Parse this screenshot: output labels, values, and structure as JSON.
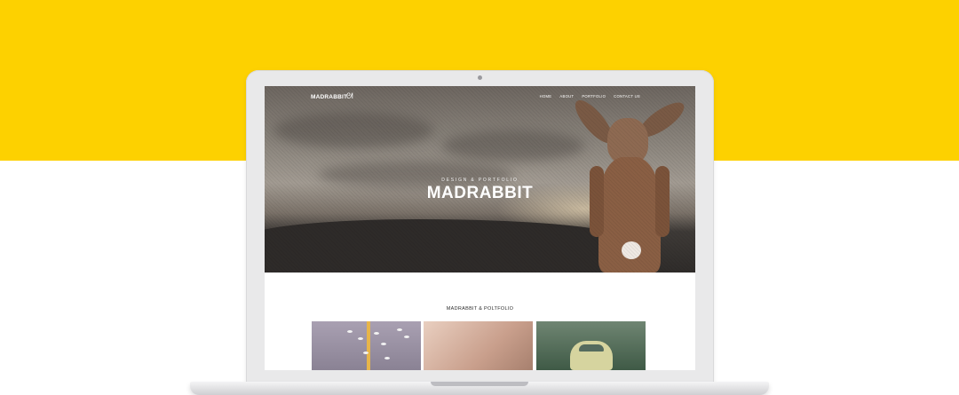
{
  "brand": {
    "logo_text": "MADRABBIT"
  },
  "nav": {
    "items": [
      "HOME",
      "ABOUT",
      "PORTFOLIO",
      "CONTACT US"
    ]
  },
  "hero": {
    "subtitle": "DESIGN & PORTFOLIO",
    "title": "MADRABBIT"
  },
  "section": {
    "title": "MADRABBIT & POLTFOLIO"
  },
  "thumbnails": [
    {
      "name": "road-birds"
    },
    {
      "name": "clothespins"
    },
    {
      "name": "vintage-car"
    }
  ],
  "colors": {
    "accent_yellow": "#fdd100",
    "laptop_silver": "#e9e9ea"
  },
  "icons": {
    "logo_mark": "rabbit-icon"
  }
}
